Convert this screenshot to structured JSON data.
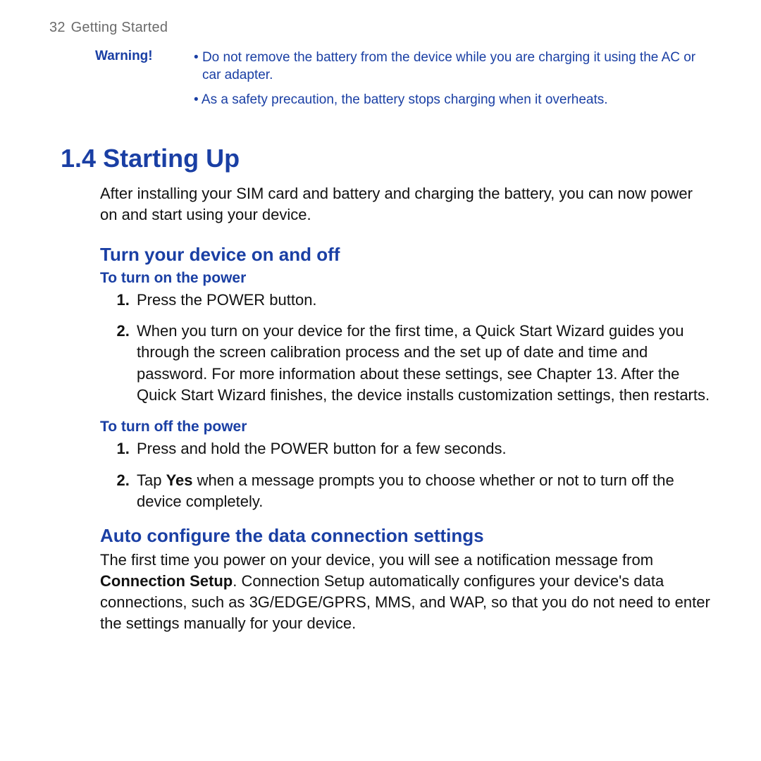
{
  "runningHead": {
    "pageNumber": "32",
    "chapter": "Getting Started"
  },
  "warning": {
    "label": "Warning!",
    "items": [
      "Do not remove the battery from the device while you are charging it using the AC or car adapter.",
      "As a safety precaution, the battery stops charging when it overheats."
    ]
  },
  "section": {
    "number": "1.4",
    "title": "Starting Up",
    "intro": "After installing your SIM card and battery and charging the battery, you can now power on and start using your device."
  },
  "sub1": {
    "title": "Turn your device on and off",
    "onHeading": "To turn on the power",
    "onSteps": [
      "Press the POWER button.",
      "When you turn on your device for the first time, a Quick Start Wizard guides you through the screen calibration process and the set up of date and time and password. For more information about these settings, see Chapter 13. After the Quick Start Wizard finishes, the device installs customization settings, then restarts."
    ],
    "offHeading": "To turn off the power",
    "offSteps": {
      "s1": "Press and hold the POWER button for a few seconds.",
      "s2_pre": "Tap ",
      "s2_bold": "Yes",
      "s2_post": " when a message prompts you to choose whether or not to turn off the device completely."
    }
  },
  "sub2": {
    "title": "Auto configure the data connection settings",
    "para_pre": "The first time you power on your device, you will see a notification message from ",
    "para_bold": "Connection Setup",
    "para_post": ". Connection Setup automatically configures your device's data connections, such as 3G/EDGE/GPRS, MMS, and WAP, so that you do not need to enter the settings manually for your device."
  }
}
